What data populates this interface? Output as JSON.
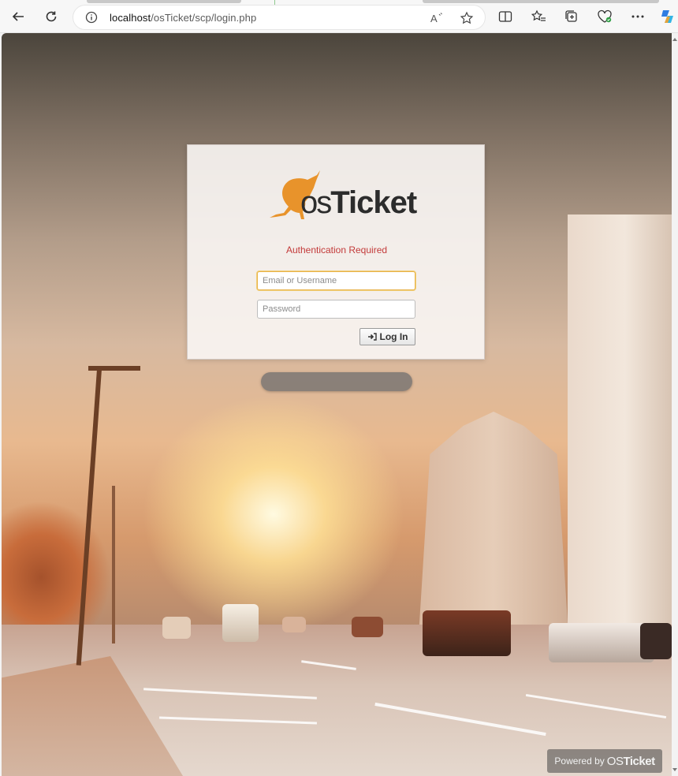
{
  "browser": {
    "url_host": "localhost",
    "url_path": "/osTicket/scp/login.php"
  },
  "login": {
    "brand_prefix": "os",
    "brand_name": "Ticket",
    "auth_message": "Authentication Required",
    "username_placeholder": "Email or Username",
    "password_placeholder": "Password",
    "login_button_label": "Log In"
  },
  "footer": {
    "powered_by_label": "Powered by",
    "brand_prefix": "OS",
    "brand_name": "Ticket"
  },
  "colors": {
    "auth_message": "#c33a3a",
    "logo_kangaroo": "#e8932b",
    "focus_border": "#e8b34a"
  },
  "icons": {
    "back": "back-arrow-icon",
    "refresh": "refresh-icon",
    "site_info": "info-icon",
    "read_aloud": "read-aloud-icon",
    "favorite": "star-icon",
    "split_screen": "split-screen-icon",
    "favorites": "favorites-icon",
    "collections": "collections-icon",
    "browser_essentials": "browser-essentials-icon",
    "more": "more-icon",
    "copilot": "copilot-icon",
    "login_button": "sign-in-icon"
  }
}
